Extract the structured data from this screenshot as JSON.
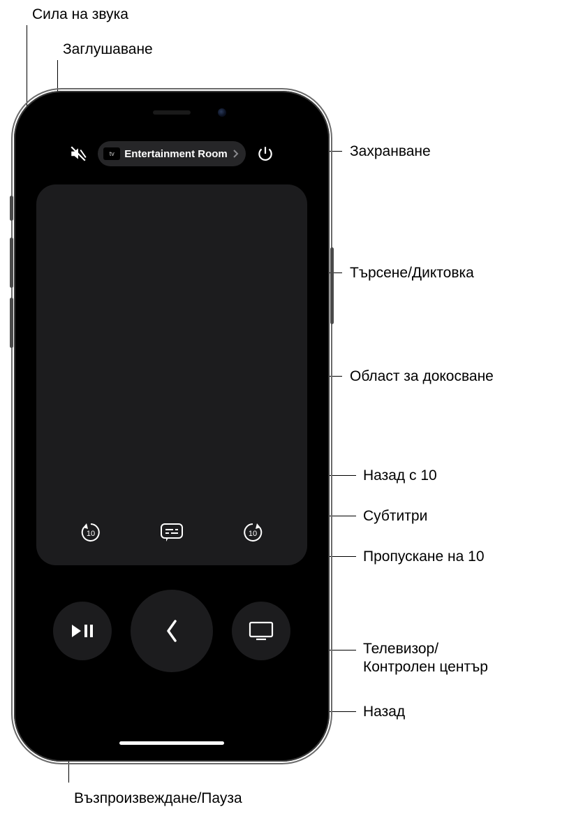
{
  "device": {
    "selector_label": "Entertainment Room",
    "atv_badge": "tv"
  },
  "callouts": {
    "volume": "Сила на звука",
    "mute": "Заглушаване",
    "power": "Захранване",
    "search_dictation": "Търсене/Диктовка",
    "touch_area": "Област за докосване",
    "skip_back_10": "Назад с 10",
    "subtitles": "Субтитри",
    "skip_fwd_10": "Пропускане на 10",
    "tv_control_line1": "Телевизор/",
    "tv_control_line2": "Контролен център",
    "back": "Назад",
    "play_pause": "Възпроизвеждане/Пауза"
  },
  "icons": {
    "mute": "mute-icon",
    "power": "power-icon",
    "skip_back": "skip-back-10-icon",
    "captions": "captions-icon",
    "skip_fwd": "skip-forward-10-icon",
    "play_pause": "play-pause-icon",
    "back": "chevron-left-icon",
    "tv": "tv-icon",
    "chevron_right": "chevron-right-icon"
  }
}
